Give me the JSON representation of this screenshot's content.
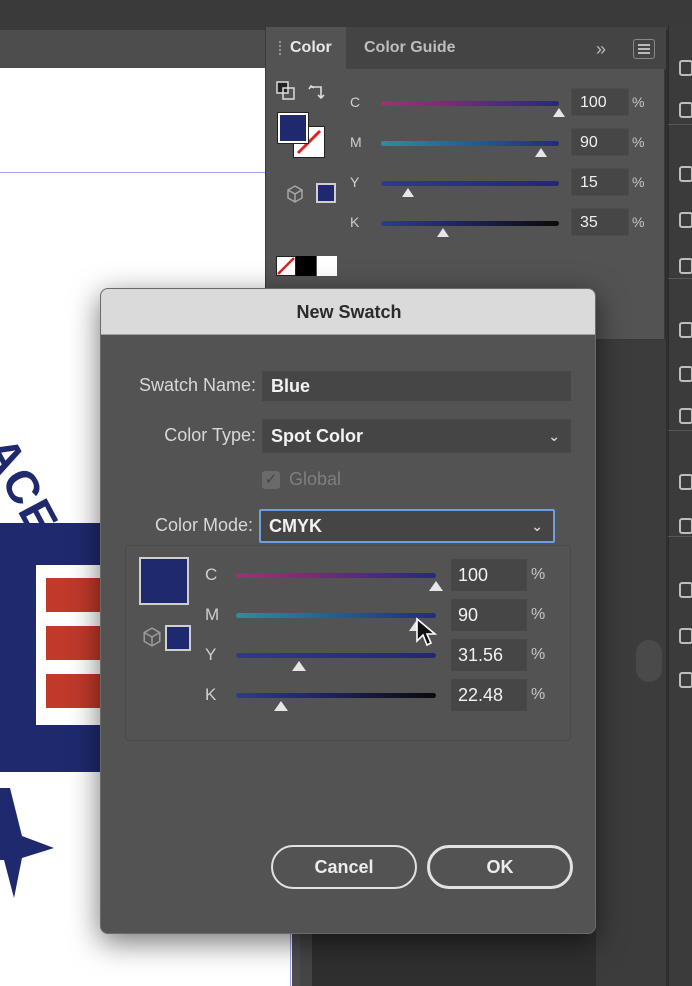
{
  "color_panel": {
    "tabs": [
      {
        "label": "Color"
      },
      {
        "label": "Color Guide"
      }
    ],
    "collapse_glyph": "»",
    "sliders": [
      {
        "label": "C",
        "value": "100",
        "unit": "%",
        "level": 1.0,
        "gradient": [
          "#a4306e",
          "#242b7a"
        ]
      },
      {
        "label": "M",
        "value": "90",
        "unit": "%",
        "level": 0.9,
        "gradient": [
          "#2d8f99",
          "#242b7a"
        ]
      },
      {
        "label": "Y",
        "value": "15",
        "unit": "%",
        "level": 0.15,
        "gradient": [
          "#2f3a8f",
          "#23286e"
        ]
      },
      {
        "label": "K",
        "value": "35",
        "unit": "%",
        "level": 0.35,
        "gradient": [
          "#2e3a98",
          "#0a0a0a"
        ]
      }
    ],
    "fill_color": "#1f2a6e"
  },
  "dialog": {
    "title": "New Swatch",
    "swatch_name_label": "Swatch Name:",
    "swatch_name_value": "Blue",
    "color_type_label": "Color Type:",
    "color_type_value": "Spot Color",
    "global_label": "Global",
    "global_checked": true,
    "color_mode_label": "Color Mode:",
    "color_mode_value": "CMYK",
    "swatch_color": "#1f2a6e",
    "sliders": [
      {
        "label": "C",
        "value": "100",
        "unit": "%",
        "level": 1.0,
        "gradient": [
          "#a4306e",
          "#242b7a"
        ]
      },
      {
        "label": "M",
        "value": "90",
        "unit": "%",
        "level": 0.9,
        "gradient": [
          "#2d8f99",
          "#242b7a"
        ]
      },
      {
        "label": "Y",
        "value": "31.56",
        "unit": "%",
        "level": 0.3156,
        "gradient": [
          "#2f3a8f",
          "#23286e"
        ]
      },
      {
        "label": "K",
        "value": "22.48",
        "unit": "%",
        "level": 0.2248,
        "gradient": [
          "#2e3a98",
          "#0a0a0a"
        ]
      }
    ],
    "cancel_label": "Cancel",
    "ok_label": "OK"
  },
  "artboard": {
    "logo_text": "ACES",
    "brand_colors": {
      "navy": "#1f2a6e",
      "red": "#c0392b"
    }
  },
  "accent": "#6fa0de"
}
